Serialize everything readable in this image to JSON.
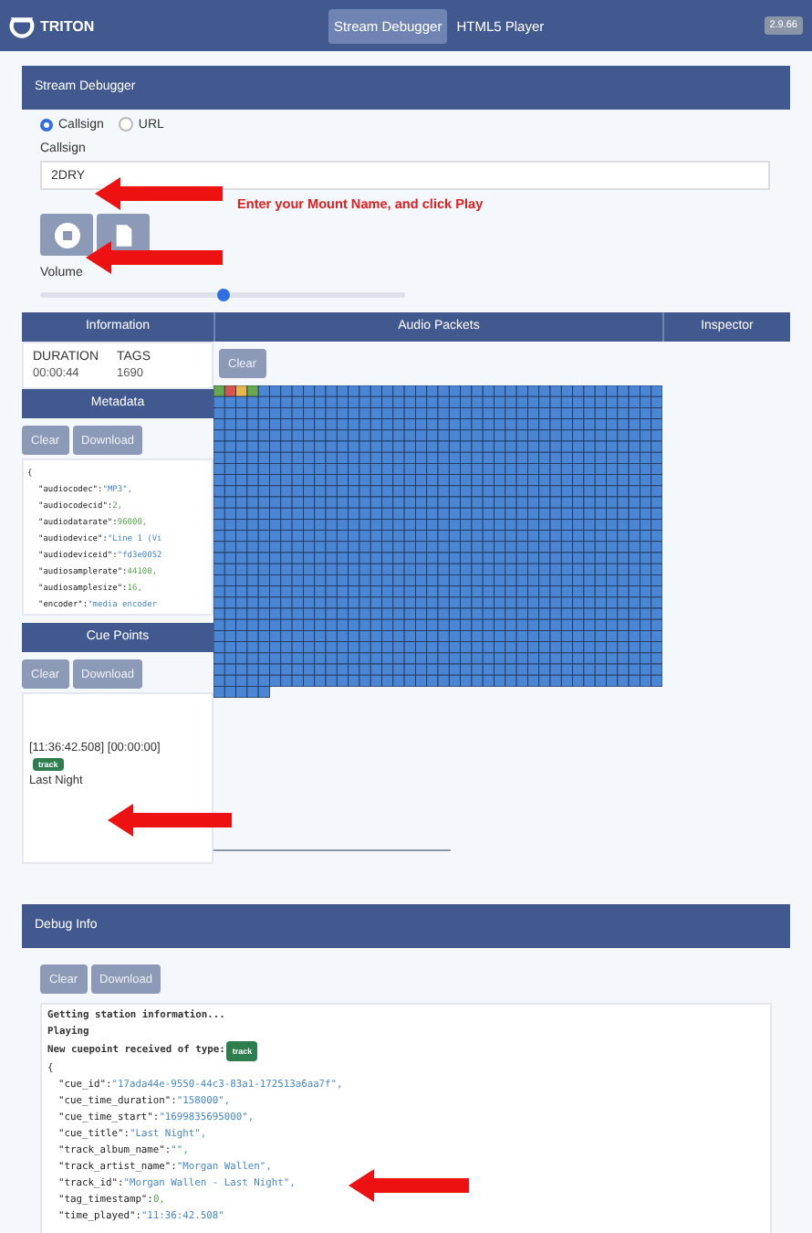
{
  "header": {
    "logo": "TRITON",
    "nav": [
      {
        "label": "Stream Debugger",
        "selected": true
      },
      {
        "label": "HTML5 Player",
        "selected": false
      }
    ],
    "version": "2.9.66"
  },
  "stream_debugger": {
    "title": "Stream Debugger",
    "source_options": [
      {
        "label": "Callsign",
        "selected": true
      },
      {
        "label": "URL",
        "selected": false
      }
    ],
    "callsign_label": "Callsign",
    "callsign_value": "2DRY",
    "annotation": "Enter your Mount Name, and click Play",
    "volume_label": "Volume",
    "volume": {
      "level": 0.5
    }
  },
  "columns": [
    "Information",
    "Audio Packets",
    "Inspector"
  ],
  "information": {
    "headers": [
      "DURATION",
      "TAGS"
    ],
    "values": [
      "00:00:44",
      "1690"
    ]
  },
  "metadata": {
    "title": "Metadata",
    "buttons": [
      "Clear",
      "Download"
    ],
    "open": "{",
    "lines": [
      {
        "key": "\"audiocodec\":",
        "value": "\"MP3\",",
        "kind": "string"
      },
      {
        "key": "\"audiocodecid\":",
        "value": "2,",
        "kind": "number"
      },
      {
        "key": "\"audiodatarate\":",
        "value": "96000,",
        "kind": "number"
      },
      {
        "key": "\"audiodevice\":",
        "value": "\"Line 1 (Vi",
        "kind": "string"
      },
      {
        "key": "\"audiodeviceid\":",
        "value": "\"fd3e0052",
        "kind": "string"
      },
      {
        "key": "\"audiosamplerate\":",
        "value": "44100,",
        "kind": "number"
      },
      {
        "key": "\"audiosamplesize\":",
        "value": "16,",
        "kind": "number"
      },
      {
        "key": "\"encoder\":",
        "value": "\"media encoder",
        "kind": "string"
      }
    ]
  },
  "cue_points": {
    "title": "Cue Points",
    "buttons": [
      "Clear",
      "Download"
    ],
    "time": "[11:36:42.508] [00:00:00]",
    "badge": "track",
    "name": "Last Night"
  },
  "audio_packets": {
    "button": "Clear"
  },
  "debug_info": {
    "title": "Debug Info",
    "buttons": [
      "Clear",
      "Download"
    ],
    "messages": [
      "Getting station information...",
      "Playing"
    ],
    "cue_message": "New cuepoint received of type:",
    "cue_badge": "track",
    "open": "{",
    "lines": [
      {
        "key": "\"cue_id\":",
        "value": "\"17ada44e-9550-44c3-83a1-172513a6aa7f\",",
        "kind": "string"
      },
      {
        "key": "\"cue_time_duration\":",
        "value": "\"158000\",",
        "kind": "string"
      },
      {
        "key": "\"cue_time_start\":",
        "value": "\"1699835695000\",",
        "kind": "string"
      },
      {
        "key": "\"cue_title\":",
        "value": "\"Last Night\",",
        "kind": "string"
      },
      {
        "key": "\"track_album_name\":",
        "value": "\"\",",
        "kind": "string"
      },
      {
        "key": "\"track_artist_name\":",
        "value": "\"Morgan Wallen\",",
        "kind": "string"
      },
      {
        "key": "\"track_id\":",
        "value": "\"Morgan Wallen - Last Night\",",
        "kind": "string"
      },
      {
        "key": "\"tag_timestamp\":",
        "value": "0,",
        "kind": "number"
      },
      {
        "key": "\"time_played\":",
        "value": "\"11:36:42.508\"",
        "kind": "string"
      }
    ]
  }
}
